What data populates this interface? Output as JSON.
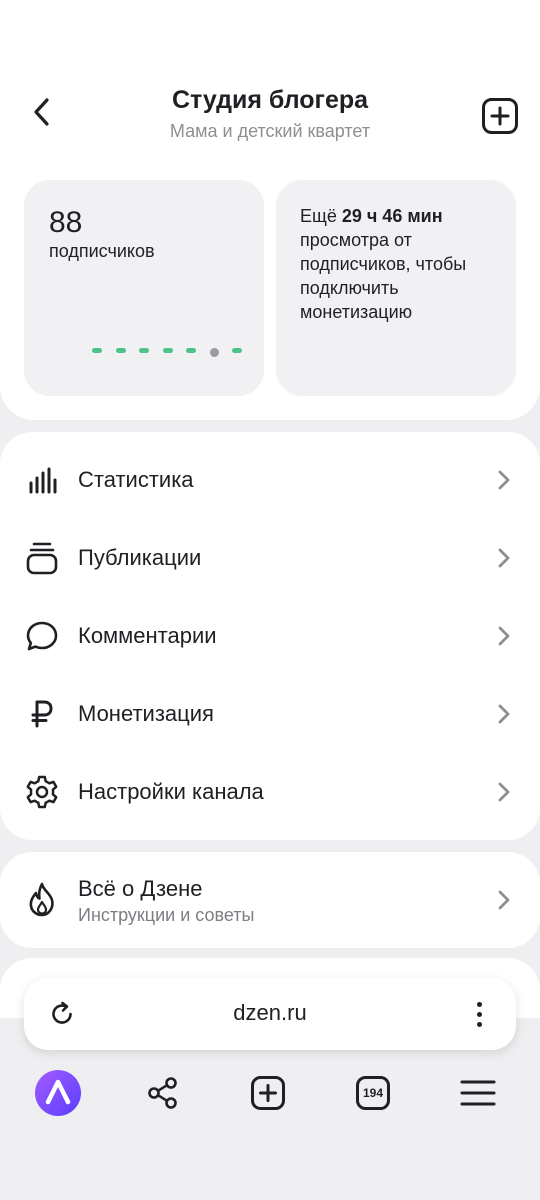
{
  "header": {
    "title": "Студия блогера",
    "subtitle": "Мама и детский квартет"
  },
  "subscribers": {
    "count": "88",
    "label": "подписчиков",
    "dot_colors": [
      "#4cc28a",
      "#9a9aa0"
    ]
  },
  "monetization_card": {
    "prefix": "Ещё ",
    "time": "29 ч 46 мин",
    "suffix": "просмотра от подписчиков, чтобы подключить монетизацию"
  },
  "menu": {
    "items": [
      {
        "label": "Статистика",
        "icon": "bar-chart-icon"
      },
      {
        "label": "Публикации",
        "icon": "stack-icon"
      },
      {
        "label": "Комментарии",
        "icon": "chat-bubble-icon"
      },
      {
        "label": "Монетизация",
        "icon": "ruble-icon"
      },
      {
        "label": "Настройки канала",
        "icon": "gear-icon"
      }
    ]
  },
  "about": {
    "title": "Всё о Дзене",
    "subtitle": "Инструкции и советы",
    "icon": "flame-icon"
  },
  "browser": {
    "url": "dzen.ru",
    "tabs_count": "194"
  },
  "colors": {
    "accent_purple": "#7c4dff",
    "text_primary": "#1f1f24",
    "text_secondary": "#8e8e93",
    "background": "#efeff1"
  }
}
